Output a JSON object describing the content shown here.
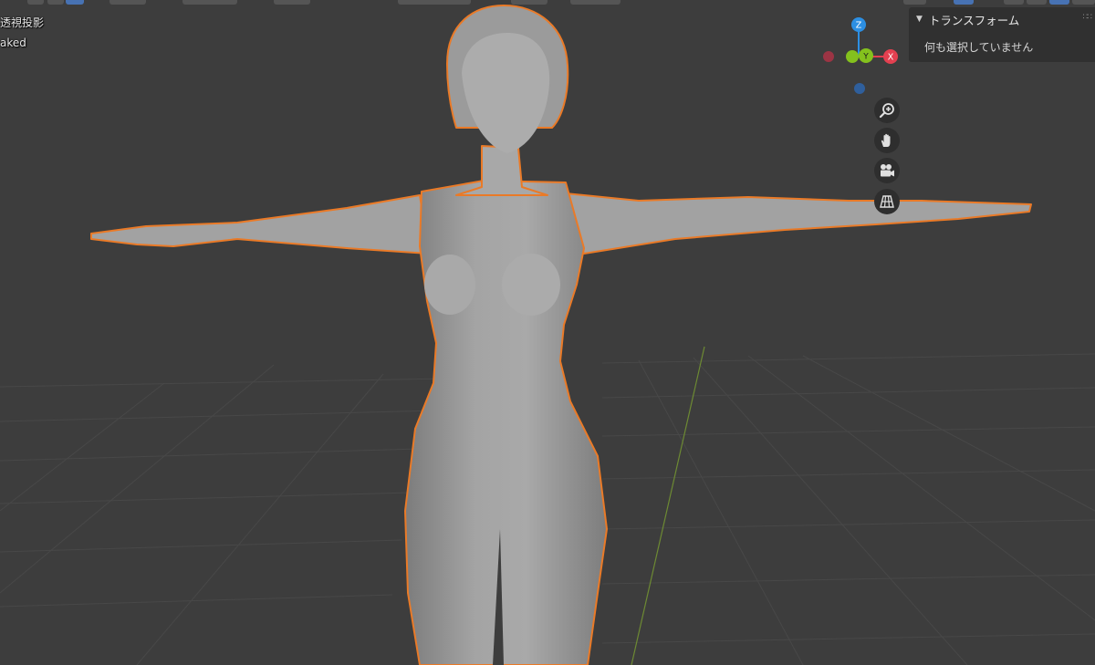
{
  "viewport": {
    "header_line1": "透視投影",
    "header_line2": "aked"
  },
  "gizmo": {
    "axis_z": "Z",
    "axis_y": "Y",
    "axis_x": "X",
    "colors": {
      "x": "#e34050",
      "y": "#84c11d",
      "z": "#2c8fe3",
      "neg_x": "#9c3444",
      "neg_z": "#2f5f9c"
    }
  },
  "nav_buttons": [
    {
      "icon": "zoom-in-icon"
    },
    {
      "icon": "hand-pan-icon"
    },
    {
      "icon": "camera-icon"
    },
    {
      "icon": "grid-ortho-icon"
    }
  ],
  "n_panel": {
    "title": "トランスフォーム",
    "collapse_icon": "triangle-down-icon",
    "empty_message": "何も選択していません"
  },
  "colors": {
    "background": "#3d3d3d",
    "selection_outline": "#ea7a27",
    "model": "#9d9d9d",
    "y_axis_line": "#6d8a33"
  }
}
